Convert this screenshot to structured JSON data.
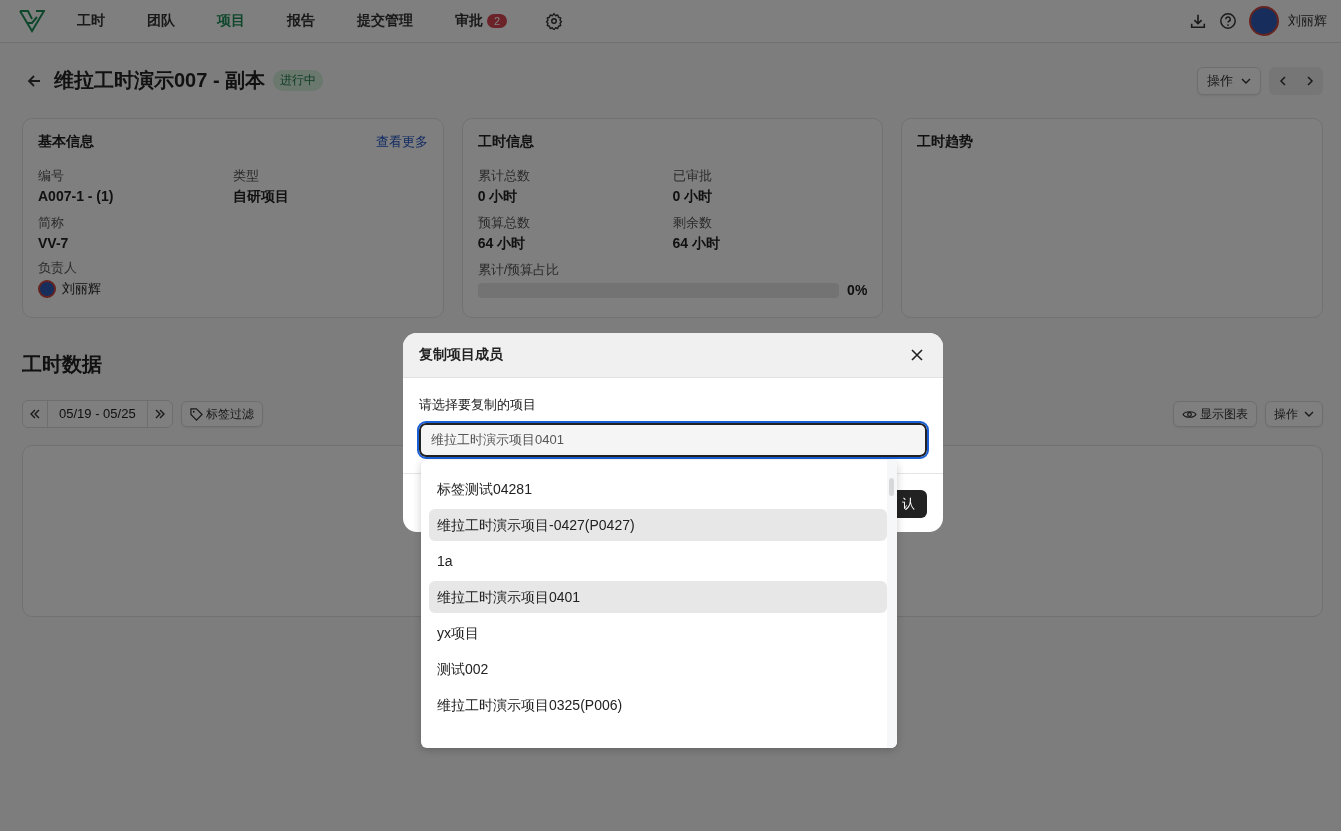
{
  "nav": {
    "items": [
      {
        "label": "工时",
        "selected": false
      },
      {
        "label": "团队",
        "selected": false
      },
      {
        "label": "项目",
        "selected": true
      },
      {
        "label": "报告",
        "selected": false
      },
      {
        "label": "提交管理",
        "selected": false
      },
      {
        "label": "审批",
        "selected": false,
        "badge": "2"
      }
    ],
    "user": {
      "name": "刘丽辉"
    }
  },
  "header": {
    "title": "维拉工时演示007 - 副本",
    "status": "进行中",
    "actions": "操作"
  },
  "basic_info": {
    "title": "基本信息",
    "link": "查看更多",
    "fields": [
      {
        "label": "编号",
        "value": "A007-1 - (1)"
      },
      {
        "label": "类型",
        "value": "自研项目"
      },
      {
        "label": "简称",
        "value": "VV-7"
      }
    ],
    "owner": {
      "label": "负责人",
      "name": "刘丽辉"
    }
  },
  "hours_info": {
    "title": "工时信息",
    "fields": [
      {
        "label": "累计总数",
        "value": "0 小时"
      },
      {
        "label": "已审批",
        "value": "0 小时"
      },
      {
        "label": "预算总数",
        "value": "64 小时"
      },
      {
        "label": "剩余数",
        "value": "64 小时"
      }
    ],
    "ratio": {
      "label": "累计/预算占比",
      "level": 0,
      "reading": "0%"
    }
  },
  "trend": {
    "title": "工时趋势"
  },
  "hours_data": {
    "title": "工时数据",
    "date_range": "05/19 - 05/25",
    "tag_filter": "标签过滤",
    "show_chart": "显示图表",
    "actions": "操作"
  },
  "dialog": {
    "title": "复制项目成员",
    "field_label": "请选择要复制的项目",
    "value": "维拉工时演示项目0401",
    "confirm": "认"
  },
  "dropdown": {
    "items": [
      {
        "label": "标签测试04281",
        "highlighted": false
      },
      {
        "label": "维拉工时演示项目-0427(P0427)",
        "highlighted": true
      },
      {
        "label": "1a",
        "highlighted": false
      },
      {
        "label": "维拉工时演示项目0401",
        "highlighted": true
      },
      {
        "label": "yx项目",
        "highlighted": false
      },
      {
        "label": "测试002",
        "highlighted": false
      },
      {
        "label": "维拉工时演示项目0325(P006)",
        "highlighted": false
      }
    ]
  }
}
